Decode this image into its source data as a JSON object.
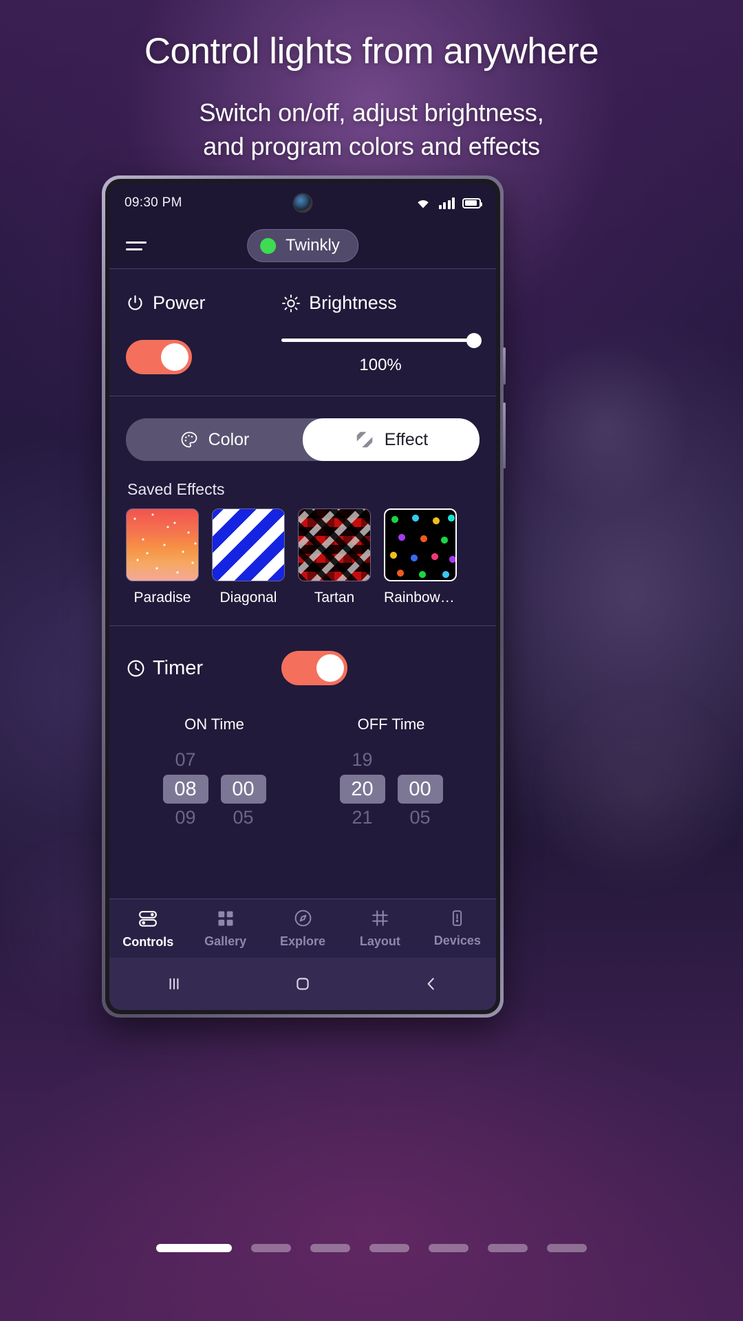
{
  "marketing": {
    "headline": "Control lights from anywhere",
    "subhead_line1": "Switch on/off, adjust brightness,",
    "subhead_line2": "and program colors and effects"
  },
  "status_bar": {
    "time": "09:30 PM",
    "wifi_icon": "wifi-icon",
    "signal_icon": "cellular-signal-icon",
    "battery_icon": "battery-icon"
  },
  "app_header": {
    "menu_icon": "hamburger-menu-icon",
    "device_status_dot": "online-status-dot",
    "device_name": "Twinkly"
  },
  "power_section": {
    "power_label": "Power",
    "power_icon": "power-icon",
    "power_on": true,
    "brightness_label": "Brightness",
    "brightness_icon": "brightness-sun-icon",
    "brightness_value": "100%"
  },
  "mode_tabs": {
    "color_label": "Color",
    "color_icon": "palette-icon",
    "effect_label": "Effect",
    "effect_icon": "effect-stripes-icon",
    "active": "Effect"
  },
  "saved_effects": {
    "title": "Saved Effects",
    "items": [
      {
        "label": "Paradise",
        "thumb": "th-paradise",
        "selected": false
      },
      {
        "label": "Diagonal",
        "thumb": "th-diagonal",
        "selected": false
      },
      {
        "label": "Tartan",
        "thumb": "th-tartan",
        "selected": false
      },
      {
        "label": "Rainbow R...",
        "thumb": "th-rainbow",
        "selected": true
      }
    ]
  },
  "timer": {
    "label": "Timer",
    "clock_icon": "clock-icon",
    "enabled": true,
    "on_time": {
      "title": "ON Time",
      "hour_prev": "07",
      "hour_sel": "08",
      "hour_next": "09",
      "min_prev": "",
      "min_sel": "00",
      "min_next": "05"
    },
    "off_time": {
      "title": "OFF Time",
      "hour_prev": "19",
      "hour_sel": "20",
      "hour_next": "21",
      "min_prev": "",
      "min_sel": "00",
      "min_next": "05"
    }
  },
  "bottom_nav": {
    "items": [
      {
        "label": "Controls",
        "icon": "sliders-icon",
        "active": true
      },
      {
        "label": "Gallery",
        "icon": "grid-icon",
        "active": false
      },
      {
        "label": "Explore",
        "icon": "compass-icon",
        "active": false
      },
      {
        "label": "Layout",
        "icon": "hash-grid-icon",
        "active": false
      },
      {
        "label": "Devices",
        "icon": "device-icon",
        "active": false
      }
    ]
  },
  "system_nav": {
    "recents_icon": "recents-icon",
    "home_icon": "home-icon",
    "back_icon": "back-icon"
  },
  "carousel": {
    "total": 7,
    "active_index": 0
  },
  "colors": {
    "accent": "#f4705c",
    "online": "#3ddc52",
    "card_bg": "#211a3a",
    "header_bg": "#1d1734"
  }
}
